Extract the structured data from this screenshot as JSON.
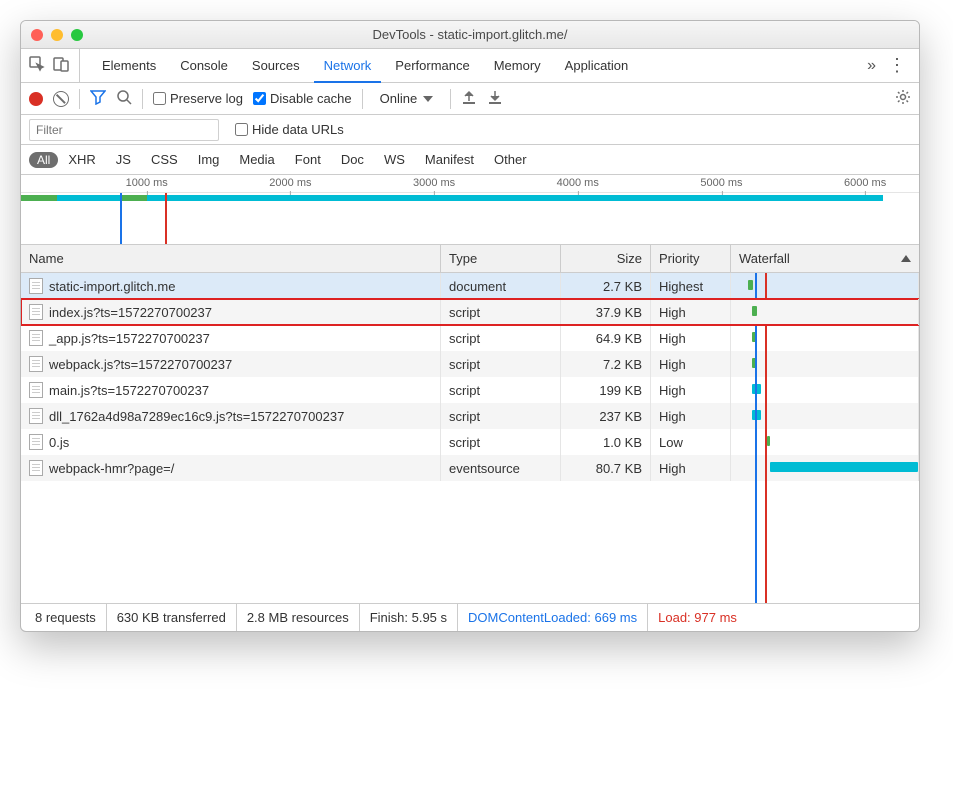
{
  "window": {
    "title": "DevTools - static-import.glitch.me/"
  },
  "tabs": {
    "items": [
      "Elements",
      "Console",
      "Sources",
      "Network",
      "Performance",
      "Memory",
      "Application"
    ],
    "active": "Network"
  },
  "toolbar": {
    "preserve_log_label": "Preserve log",
    "preserve_log_checked": false,
    "disable_cache_label": "Disable cache",
    "disable_cache_checked": true,
    "throttling": "Online"
  },
  "filterbar": {
    "placeholder": "Filter",
    "hide_data_urls_label": "Hide data URLs",
    "hide_data_urls_checked": false
  },
  "type_filters": {
    "all_label": "All",
    "items": [
      "XHR",
      "JS",
      "CSS",
      "Img",
      "Media",
      "Font",
      "Doc",
      "WS",
      "Manifest",
      "Other"
    ]
  },
  "overview": {
    "ticks": [
      {
        "label": "1000 ms",
        "pos_pct": 14
      },
      {
        "label": "2000 ms",
        "pos_pct": 30
      },
      {
        "label": "3000 ms",
        "pos_pct": 46
      },
      {
        "label": "4000 ms",
        "pos_pct": 62
      },
      {
        "label": "5000 ms",
        "pos_pct": 78
      },
      {
        "label": "6000 ms",
        "pos_pct": 94
      }
    ],
    "segments": [
      {
        "left_pct": 0,
        "width_pct": 4,
        "color": "#4caf50"
      },
      {
        "left_pct": 4,
        "width_pct": 7,
        "color": "#00bcd4"
      },
      {
        "left_pct": 11,
        "width_pct": 3,
        "color": "#4caf50"
      },
      {
        "left_pct": 14,
        "width_pct": 82,
        "color": "#00bcd4"
      }
    ],
    "vlines": [
      {
        "pos_pct": 11,
        "color": "#1a73e8"
      },
      {
        "pos_pct": 16,
        "color": "#d93025"
      }
    ]
  },
  "columns": {
    "name": "Name",
    "type": "Type",
    "size": "Size",
    "priority": "Priority",
    "waterfall": "Waterfall"
  },
  "requests": [
    {
      "name": "static-import.glitch.me",
      "type": "document",
      "size": "2.7 KB",
      "priority": "Highest",
      "selected": true,
      "highlight": false,
      "wf": {
        "left_pct": 9,
        "width_pct": 3,
        "color": "#4caf50"
      }
    },
    {
      "name": "index.js?ts=1572270700237",
      "type": "script",
      "size": "37.9 KB",
      "priority": "High",
      "selected": false,
      "highlight": true,
      "wf": {
        "left_pct": 11,
        "width_pct": 3,
        "color": "#4caf50"
      }
    },
    {
      "name": "_app.js?ts=1572270700237",
      "type": "script",
      "size": "64.9 KB",
      "priority": "High",
      "selected": false,
      "highlight": false,
      "wf": {
        "left_pct": 11,
        "width_pct": 3,
        "color": "#4caf50"
      }
    },
    {
      "name": "webpack.js?ts=1572270700237",
      "type": "script",
      "size": "7.2 KB",
      "priority": "High",
      "selected": false,
      "highlight": false,
      "wf": {
        "left_pct": 11,
        "width_pct": 3,
        "color": "#4caf50"
      }
    },
    {
      "name": "main.js?ts=1572270700237",
      "type": "script",
      "size": "199 KB",
      "priority": "High",
      "selected": false,
      "highlight": false,
      "wf": {
        "left_pct": 11,
        "width_pct": 5,
        "color": "#00bcd4"
      }
    },
    {
      "name": "dll_1762a4d98a7289ec16c9.js?ts=1572270700237",
      "type": "script",
      "size": "237 KB",
      "priority": "High",
      "selected": false,
      "highlight": false,
      "wf": {
        "left_pct": 11,
        "width_pct": 5,
        "color": "#00bcd4"
      }
    },
    {
      "name": "0.js",
      "type": "script",
      "size": "1.0 KB",
      "priority": "Low",
      "selected": false,
      "highlight": false,
      "wf": {
        "left_pct": 19,
        "width_pct": 2,
        "color": "#4caf50"
      }
    },
    {
      "name": "webpack-hmr?page=/",
      "type": "eventsource",
      "size": "80.7 KB",
      "priority": "High",
      "selected": false,
      "highlight": false,
      "wf": {
        "left_pct": 21,
        "width_pct": 79,
        "color": "#00bcd4"
      }
    }
  ],
  "waterfall_vlines": [
    {
      "pos_pct": 13,
      "color": "#1a73e8"
    },
    {
      "pos_pct": 18,
      "color": "#d93025"
    }
  ],
  "status": {
    "requests": "8 requests",
    "transferred": "630 KB transferred",
    "resources": "2.8 MB resources",
    "finish": "Finish: 5.95 s",
    "dcl": "DOMContentLoaded: 669 ms",
    "load": "Load: 977 ms"
  }
}
